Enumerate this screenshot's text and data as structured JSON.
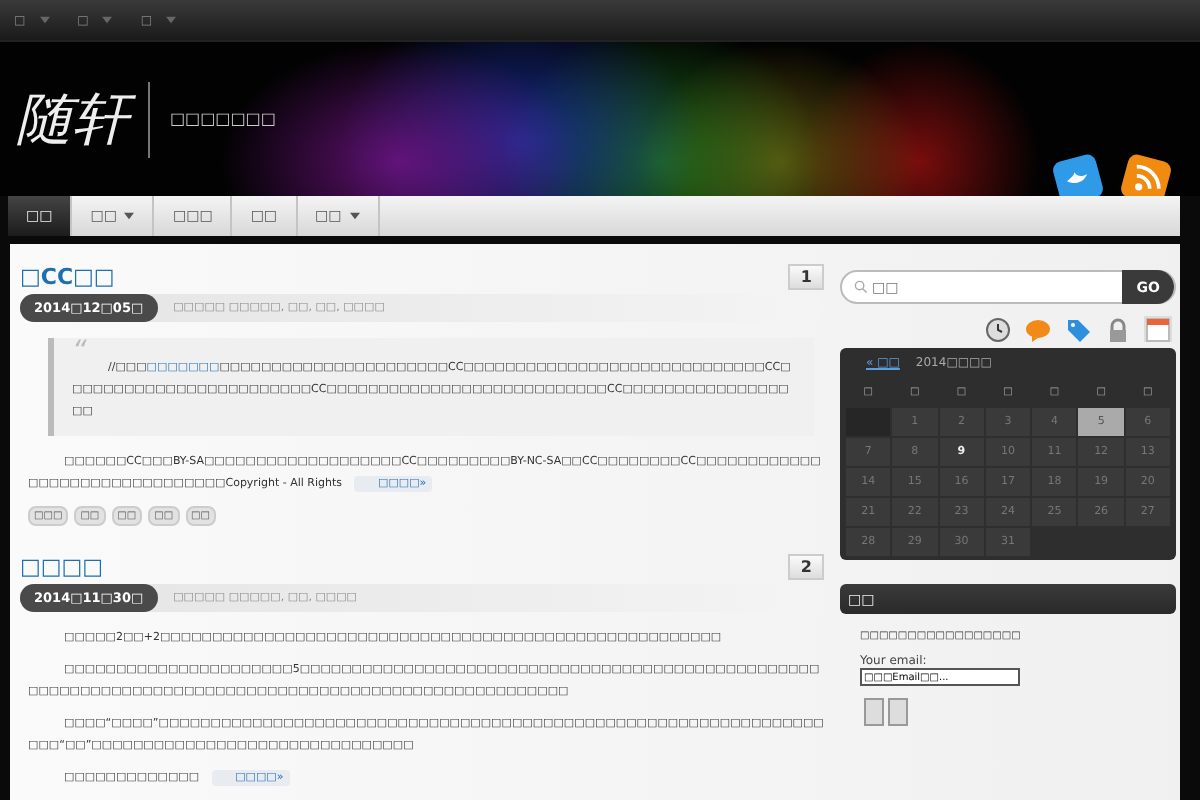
{
  "top_links": [
    {
      "label": "□",
      "dropdown": true
    },
    {
      "label": "□",
      "dropdown": true
    },
    {
      "label": "□",
      "dropdown": true
    }
  ],
  "site": {
    "logo": "随轩",
    "tagline": "□□□□□□□"
  },
  "nav": [
    {
      "label": "□□",
      "selected": true,
      "dropdown": false
    },
    {
      "label": "□□",
      "selected": false,
      "dropdown": true
    },
    {
      "label": "□□□",
      "selected": false,
      "dropdown": false
    },
    {
      "label": "□□",
      "selected": false,
      "dropdown": false
    },
    {
      "label": "□□",
      "selected": false,
      "dropdown": true
    }
  ],
  "posts": [
    {
      "title": "□CC□□",
      "comments": "1",
      "date": "2014□12□05□",
      "meta": "□□□□□ □□□□□, □□, □□, □□□□",
      "quote": {
        "mark": "“",
        "before": "//□□□",
        "link": "□□□□□□□",
        "after": "□□□□□□□□□□□□□□□□□□□□□□CC□□□□□□□□□□□□□□□□□□□□□□□□□□□□□CC□□□□□□□□□□□□□□□□□□□□□□□□CC□□□□□□□□□□□□□□□□□□□□□□□□□□□CC□□□□□□□□□□□□□□□□□□"
      },
      "paragraphs": [
        "□□□□□□CC□□□BY-SA□□□□□□□□□□□□□□□□□□□CC□□□□□□□□□BY-NC-SA□□CC□□□□□□□□CC□□□□□□□□□□□□□□□□□□□□□□□□□□□□□□□Copyright - All Rights"
      ],
      "read_more": "□□□□»",
      "tags": [
        "□□□",
        "□□",
        "□□",
        "□□",
        "□□"
      ]
    },
    {
      "title": "□□□□",
      "comments": "2",
      "date": "2014□11□30□",
      "meta": "□□□□□ □□□□□, □□, □□□□",
      "paragraphs": [
        "□□□□□2□□+2□□□□□□□□□□□□□□□□□□□□□□□□□□□□□□□□□□□□□□□□□□□□□□□□□□□□□□",
        "□□□□□□□□□□□□□□□□□□□□□□5□□□□□□□□□□□□□□□□□□□□□□□□□□□□□□□□□□□□□□□□□□□□□□□□□□□□□□□□□□□□□□□□□□□□□□□□□□□□□□□□□□□□□□□□□□□□□□□□□□□□□□",
        "□□□□“□□□□”□□□□□□□□□□□□□□□□□□□□□□□□□□□□□□□□□□□□□□□□□□□□□□□□□□□□□□□□□□□□□□□□□□□“□□”□□□□□□□□□□□□□□□□□□□□□□□□□□□□□□□",
        "□□□□□□□□□□□□□"
      ],
      "read_more": "□□□□»"
    }
  ],
  "search": {
    "placeholder": "□□",
    "button": "GO"
  },
  "sidebar_tabs": [
    {
      "kind": "clock",
      "selected": false
    },
    {
      "kind": "comment",
      "selected": false
    },
    {
      "kind": "tag",
      "selected": false
    },
    {
      "kind": "lock",
      "selected": false
    },
    {
      "kind": "calendar",
      "selected": true
    }
  ],
  "calendar": {
    "prev": "« □□",
    "title": "2014□□□□",
    "weekdays": [
      "□",
      "□",
      "□",
      "□",
      "□",
      "□",
      "□"
    ],
    "offset_blank": true,
    "days": [
      {
        "day": "1",
        "selected": false,
        "today": false
      },
      {
        "day": "2",
        "selected": false,
        "today": false
      },
      {
        "day": "3",
        "selected": false,
        "today": false
      },
      {
        "day": "4",
        "selected": false,
        "today": false
      },
      {
        "day": "5",
        "selected": true,
        "today": false
      },
      {
        "day": "6",
        "selected": false,
        "today": false
      },
      {
        "day": "7",
        "selected": false,
        "today": false
      },
      {
        "day": "8",
        "selected": false,
        "today": false
      },
      {
        "day": "9",
        "selected": false,
        "today": true
      },
      {
        "day": "10",
        "selected": false,
        "today": false
      },
      {
        "day": "11",
        "selected": false,
        "today": false
      },
      {
        "day": "12",
        "selected": false,
        "today": false
      },
      {
        "day": "13",
        "selected": false,
        "today": false
      },
      {
        "day": "14",
        "selected": false,
        "today": false
      },
      {
        "day": "15",
        "selected": false,
        "today": false
      },
      {
        "day": "16",
        "selected": false,
        "today": false
      },
      {
        "day": "17",
        "selected": false,
        "today": false
      },
      {
        "day": "18",
        "selected": false,
        "today": false
      },
      {
        "day": "19",
        "selected": false,
        "today": false
      },
      {
        "day": "20",
        "selected": false,
        "today": false
      },
      {
        "day": "21",
        "selected": false,
        "today": false
      },
      {
        "day": "22",
        "selected": false,
        "today": false
      },
      {
        "day": "23",
        "selected": false,
        "today": false
      },
      {
        "day": "24",
        "selected": false,
        "today": false
      },
      {
        "day": "25",
        "selected": false,
        "today": false
      },
      {
        "day": "26",
        "selected": false,
        "today": false
      },
      {
        "day": "27",
        "selected": false,
        "today": false
      },
      {
        "day": "28",
        "selected": false,
        "today": false
      },
      {
        "day": "29",
        "selected": false,
        "today": false
      },
      {
        "day": "30",
        "selected": false,
        "today": false
      },
      {
        "day": "31",
        "selected": false,
        "today": false
      }
    ]
  },
  "subscribe": {
    "title": "□□",
    "text": "□□□□□□□□□□□□□□□□□",
    "email_label": "Your email:",
    "email_value": "□□□Email□□..."
  }
}
